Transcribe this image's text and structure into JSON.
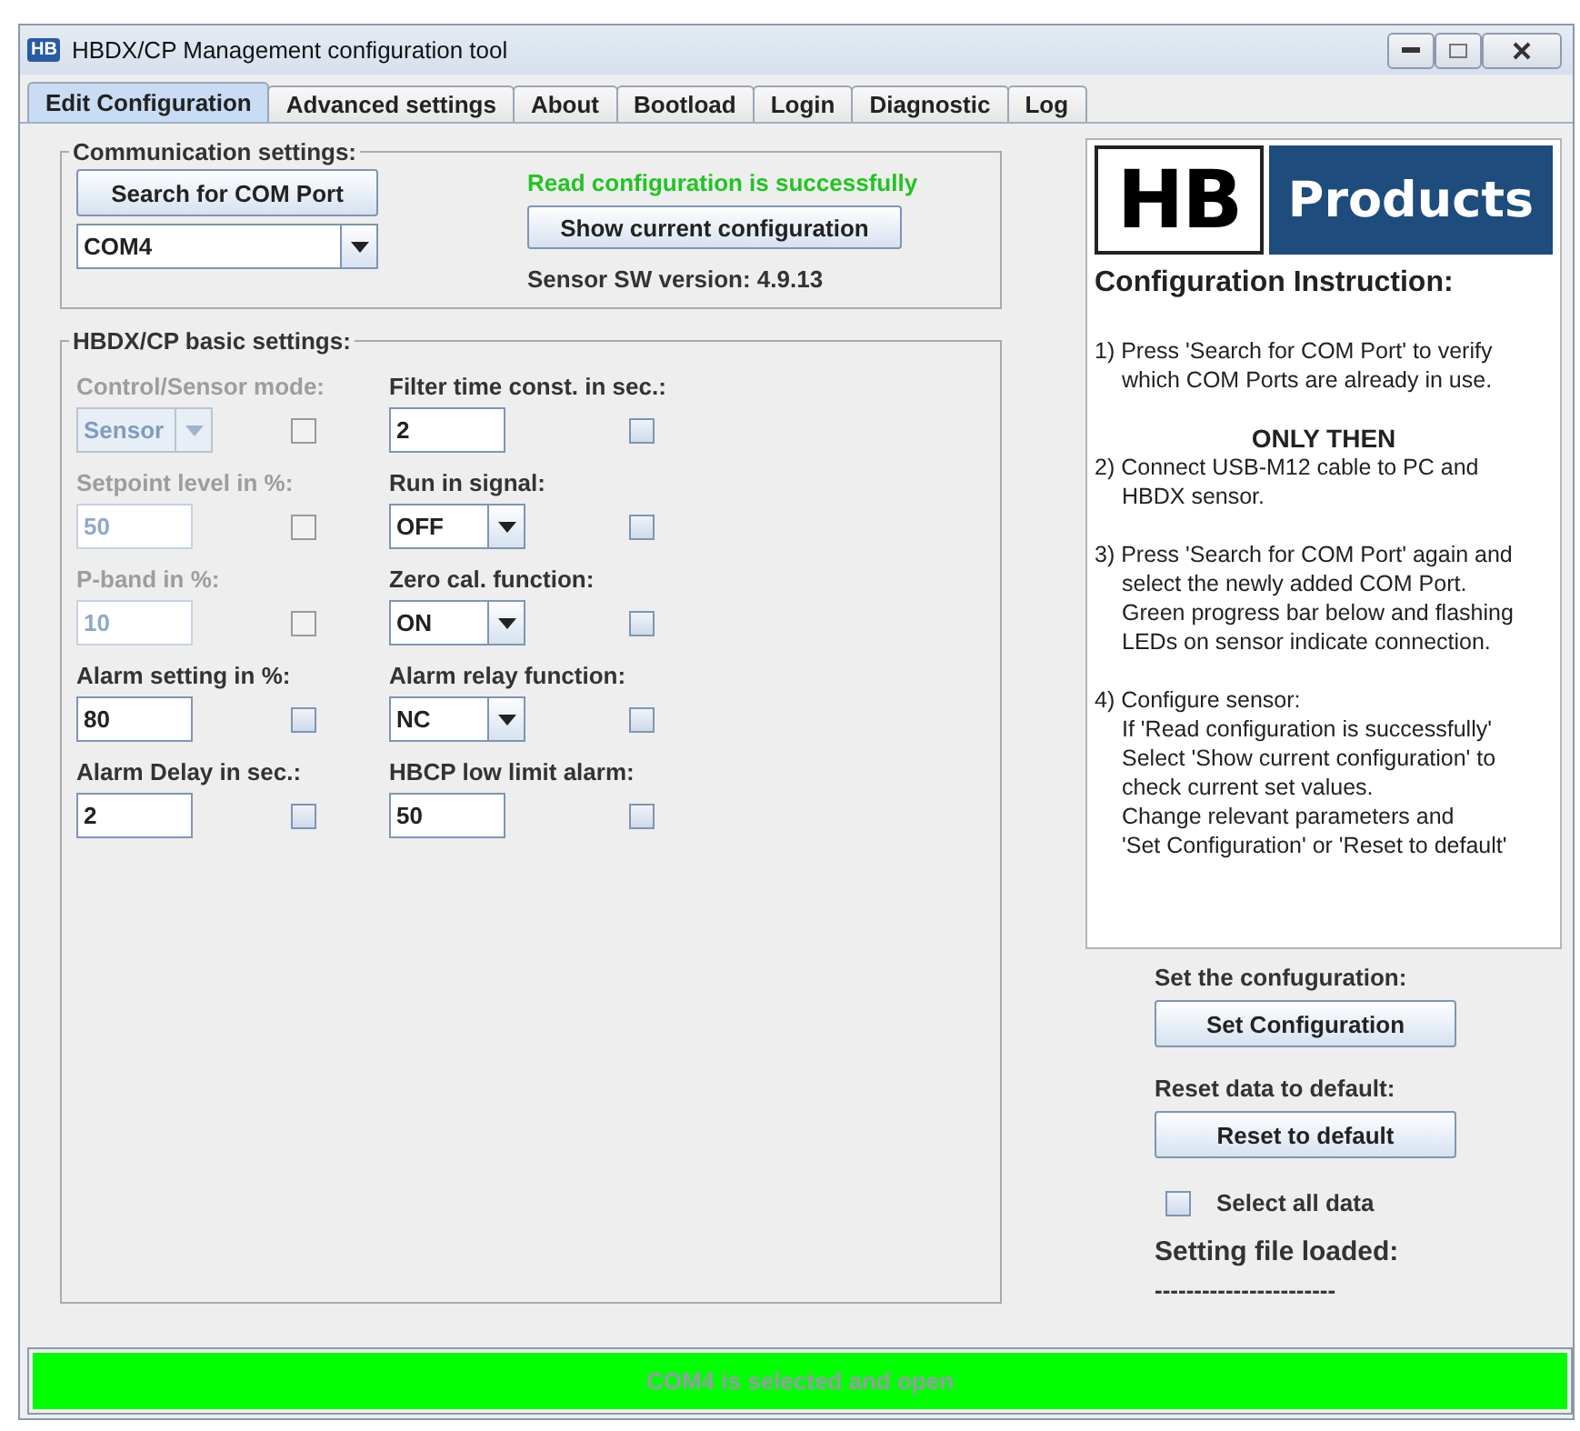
{
  "window": {
    "title": "HBDX/CP Management configuration tool",
    "app_badge": "HB"
  },
  "tabs": [
    {
      "label": "Edit Configuration",
      "selected": true
    },
    {
      "label": "Advanced settings",
      "selected": false
    },
    {
      "label": "About",
      "selected": false
    },
    {
      "label": "Bootload",
      "selected": false
    },
    {
      "label": "Login",
      "selected": false
    },
    {
      "label": "Diagnostic",
      "selected": false
    },
    {
      "label": "Log",
      "selected": false
    }
  ],
  "communication": {
    "title": "Communication settings:",
    "search_button": "Search for COM Port",
    "port": "COM4",
    "status": "Read configuration is successfully",
    "show_button": "Show current configuration",
    "version": "Sensor SW version: 4.9.13"
  },
  "basic_settings": {
    "title": "HBDX/CP basic settings:",
    "fields": [
      {
        "label": "Control/Sensor mode:",
        "kind": "combo",
        "value": "Sensor",
        "disabled": true,
        "checked": false
      },
      {
        "label": "Filter time const. in sec.:",
        "kind": "text",
        "value": "2",
        "disabled": false,
        "checked": false
      },
      {
        "label": "Setpoint level in %:",
        "kind": "text",
        "value": "50",
        "disabled": true,
        "checked": false
      },
      {
        "label": "Run in signal:",
        "kind": "combo",
        "value": "OFF",
        "disabled": false,
        "checked": false
      },
      {
        "label": "P-band in %:",
        "kind": "text",
        "value": "10",
        "disabled": true,
        "checked": false
      },
      {
        "label": "Zero cal. function:",
        "kind": "combo",
        "value": "ON",
        "disabled": false,
        "checked": false
      },
      {
        "label": "Alarm setting in %:",
        "kind": "text",
        "value": "80",
        "disabled": false,
        "checked": false
      },
      {
        "label": "Alarm relay function:",
        "kind": "combo",
        "value": "NC",
        "disabled": false,
        "checked": false
      },
      {
        "label": "Alarm Delay in sec.:",
        "kind": "text",
        "value": "2",
        "disabled": false,
        "checked": false
      },
      {
        "label": "HBCP low limit alarm:",
        "kind": "text",
        "value": "50",
        "disabled": false,
        "checked": false
      }
    ]
  },
  "logo": {
    "left": "HB",
    "right": "Products"
  },
  "instructions": {
    "title": "Configuration Instruction:",
    "blocks": [
      {
        "kind": "step",
        "lines": [
          "1) Press 'Search for COM Port' to verify",
          "which COM Ports are already in use."
        ]
      },
      {
        "kind": "emphasis",
        "lines": [
          "ONLY THEN"
        ]
      },
      {
        "kind": "step",
        "lines": [
          "2) Connect USB-M12 cable to PC and",
          "HBDX sensor."
        ]
      },
      {
        "kind": "step",
        "lines": [
          "3) Press 'Search for COM Port' again and",
          "select the newly added COM Port.",
          "Green progress bar below and flashing",
          "LEDs on sensor indicate connection."
        ]
      },
      {
        "kind": "step",
        "lines": [
          "4) Configure sensor:",
          "If 'Read configuration is successfully'",
          "Select 'Show current configuration' to",
          "check current set values.",
          "Change relevant parameters and",
          "'Set Configuration' or 'Reset to default'"
        ]
      }
    ]
  },
  "actions": {
    "set_label": "Set the confuguration:",
    "set_button": "Set Configuration",
    "reset_label": "Reset data to default:",
    "reset_button": "Reset to default",
    "select_all": {
      "label": "Select all data",
      "checked": false
    },
    "file_title": "Setting file loaded:",
    "file_value": "-----------------------"
  },
  "status_bar": {
    "text": "COM4 is selected and open",
    "level": 1
  }
}
